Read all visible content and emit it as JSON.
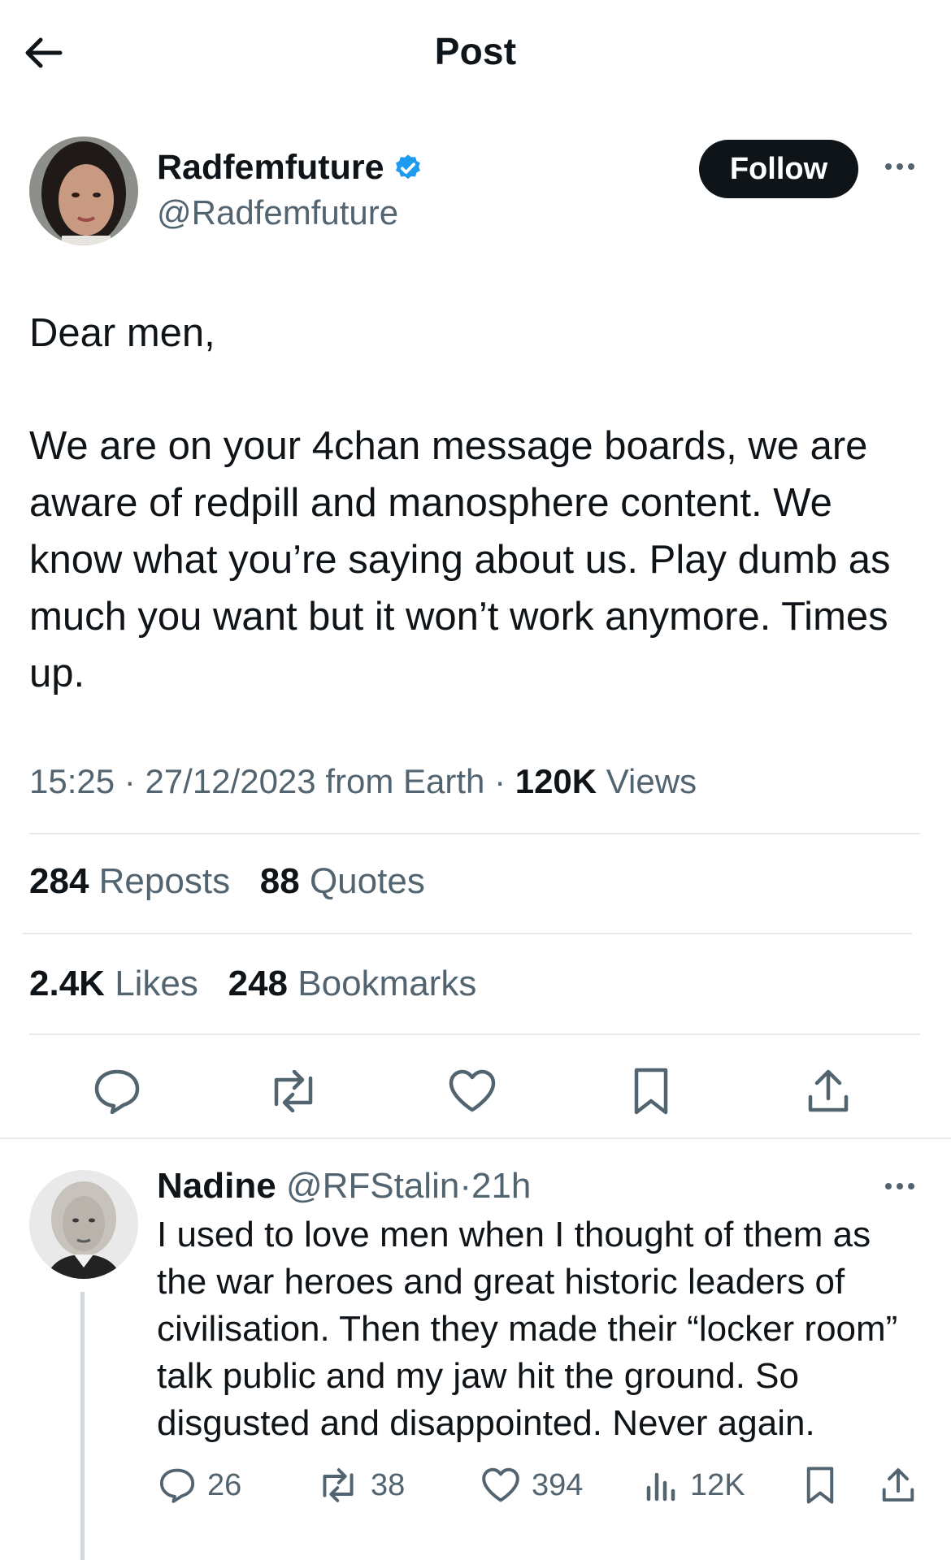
{
  "header": {
    "title": "Post"
  },
  "author": {
    "name": "Radfemfuture",
    "handle": "@Radfemfuture",
    "verified": true,
    "follow_label": "Follow"
  },
  "post": {
    "greeting": "Dear men,",
    "body": "We are on your 4chan message boards, we are aware of redpill and manosphere content. We know what you’re saying about us. Play dumb as much you want but it won’t work anymore. Times up.",
    "time": "15:25",
    "date": "27/12/2023",
    "source": "from Earth",
    "views_count": "120K",
    "views_label": "Views"
  },
  "stats": {
    "reposts": {
      "count": "284",
      "label": "Reposts"
    },
    "quotes": {
      "count": "88",
      "label": "Quotes"
    },
    "likes": {
      "count": "2.4K",
      "label": "Likes"
    },
    "bookmarks": {
      "count": "248",
      "label": "Bookmarks"
    }
  },
  "actions": [
    "reply-icon",
    "repost-icon",
    "like-icon",
    "bookmark-icon",
    "share-icon"
  ],
  "reply": {
    "author": "Nadine",
    "handle": "@RFStalin",
    "separator": "·",
    "time": "21h",
    "text": "I used to love men when I thought of them as the war heroes and great historic leaders of civilisation. Then they made their “locker room” talk public and my jaw hit the ground. So disgusted and disappointed. Never again.",
    "replies": "26",
    "reposts": "38",
    "likes": "394",
    "views": "12K"
  },
  "colors": {
    "accent": "#1d9bf0",
    "text": "#0f1419",
    "muted": "#536471",
    "divider": "#e6e9eb"
  }
}
